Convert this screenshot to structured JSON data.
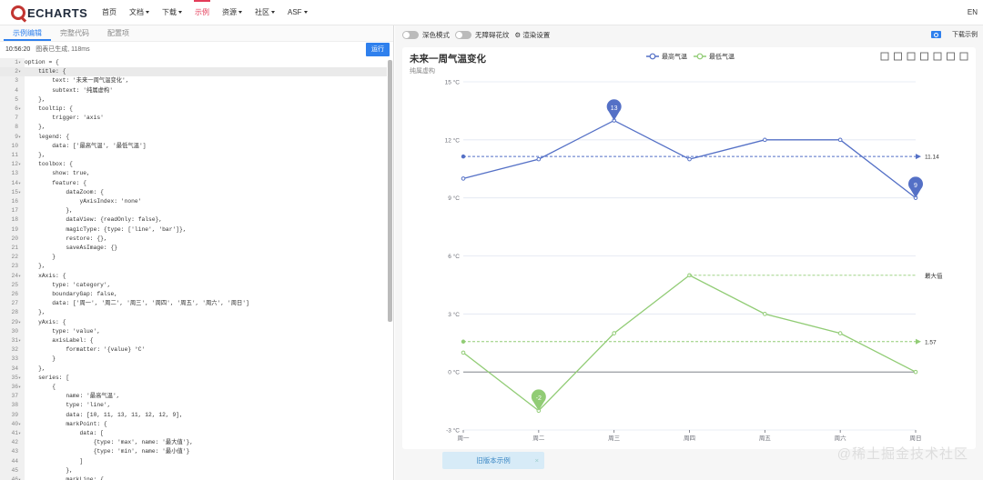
{
  "nav": {
    "logo_text": "ECHARTS",
    "items": [
      {
        "label": "首页",
        "dropdown": false,
        "active": false
      },
      {
        "label": "文档",
        "dropdown": true,
        "active": false
      },
      {
        "label": "下载",
        "dropdown": true,
        "active": false
      },
      {
        "label": "示例",
        "dropdown": false,
        "active": true
      },
      {
        "label": "资源",
        "dropdown": true,
        "active": false
      },
      {
        "label": "社区",
        "dropdown": true,
        "active": false
      },
      {
        "label": "ASF",
        "dropdown": true,
        "active": false
      }
    ],
    "lang": "EN",
    "accent_color": "#e43c59"
  },
  "editor": {
    "tabs": [
      "示例编辑",
      "完整代码",
      "配置项"
    ],
    "status_time": "10:56:20",
    "status_text": "图表已生成, 118ms",
    "run_label": "运行",
    "lines": [
      {
        "n": "1",
        "fold": "▾",
        "text": "option = {"
      },
      {
        "n": "2",
        "fold": "▾",
        "text": "    title: {"
      },
      {
        "n": "3",
        "fold": "",
        "text": "        text: '未来一周气温变化',"
      },
      {
        "n": "4",
        "fold": "",
        "text": "        subtext: '纯属虚构'"
      },
      {
        "n": "5",
        "fold": "",
        "text": "    },"
      },
      {
        "n": "6",
        "fold": "▾",
        "text": "    tooltip: {"
      },
      {
        "n": "7",
        "fold": "",
        "text": "        trigger: 'axis'"
      },
      {
        "n": "8",
        "fold": "",
        "text": "    },"
      },
      {
        "n": "9",
        "fold": "▾",
        "text": "    legend: {"
      },
      {
        "n": "10",
        "fold": "",
        "text": "        data: ['最高气温', '最低气温']"
      },
      {
        "n": "11",
        "fold": "",
        "text": "    },"
      },
      {
        "n": "12",
        "fold": "▾",
        "text": "    toolbox: {"
      },
      {
        "n": "13",
        "fold": "",
        "text": "        show: true,"
      },
      {
        "n": "14",
        "fold": "▾",
        "text": "        feature: {"
      },
      {
        "n": "15",
        "fold": "▾",
        "text": "            dataZoom: {"
      },
      {
        "n": "16",
        "fold": "",
        "text": "                yAxisIndex: 'none'"
      },
      {
        "n": "17",
        "fold": "",
        "text": "            },"
      },
      {
        "n": "18",
        "fold": "",
        "text": "            dataView: {readOnly: false},"
      },
      {
        "n": "19",
        "fold": "",
        "text": "            magicType: {type: ['line', 'bar']},"
      },
      {
        "n": "20",
        "fold": "",
        "text": "            restore: {},"
      },
      {
        "n": "21",
        "fold": "",
        "text": "            saveAsImage: {}"
      },
      {
        "n": "22",
        "fold": "",
        "text": "        }"
      },
      {
        "n": "23",
        "fold": "",
        "text": "    },"
      },
      {
        "n": "24",
        "fold": "▾",
        "text": "    xAxis: {"
      },
      {
        "n": "25",
        "fold": "",
        "text": "        type: 'category',"
      },
      {
        "n": "26",
        "fold": "",
        "text": "        boundaryGap: false,"
      },
      {
        "n": "27",
        "fold": "",
        "text": "        data: ['周一', '周二', '周三', '周四', '周五', '周六', '周日']"
      },
      {
        "n": "28",
        "fold": "",
        "text": "    },"
      },
      {
        "n": "29",
        "fold": "▾",
        "text": "    yAxis: {"
      },
      {
        "n": "30",
        "fold": "",
        "text": "        type: 'value',"
      },
      {
        "n": "31",
        "fold": "▾",
        "text": "        axisLabel: {"
      },
      {
        "n": "32",
        "fold": "",
        "text": "            formatter: '{value} °C'"
      },
      {
        "n": "33",
        "fold": "",
        "text": "        }"
      },
      {
        "n": "34",
        "fold": "",
        "text": "    },"
      },
      {
        "n": "35",
        "fold": "▾",
        "text": "    series: ["
      },
      {
        "n": "36",
        "fold": "▾",
        "text": "        {"
      },
      {
        "n": "37",
        "fold": "",
        "text": "            name: '最高气温',"
      },
      {
        "n": "38",
        "fold": "",
        "text": "            type: 'line',"
      },
      {
        "n": "39",
        "fold": "",
        "text": "            data: [10, 11, 13, 11, 12, 12, 9],"
      },
      {
        "n": "40",
        "fold": "▾",
        "text": "            markPoint: {"
      },
      {
        "n": "41",
        "fold": "▾",
        "text": "                data: ["
      },
      {
        "n": "42",
        "fold": "",
        "text": "                    {type: 'max', name: '最大值'},"
      },
      {
        "n": "43",
        "fold": "",
        "text": "                    {type: 'min', name: '最小值'}"
      },
      {
        "n": "44",
        "fold": "",
        "text": "                ]"
      },
      {
        "n": "45",
        "fold": "",
        "text": "            },"
      },
      {
        "n": "46",
        "fold": "▾",
        "text": "            markLine: {"
      }
    ]
  },
  "preview": {
    "dark_mode_label": "深色模式",
    "no_decal_label": "无障碍花纹",
    "render_settings_label": "渲染设置",
    "download_label": "下载示例",
    "old_example_label": "旧版本示例",
    "old_example_close": "×",
    "watermark": "@稀土掘金技术社区"
  },
  "chart_data": {
    "type": "line",
    "title": "未来一周气温变化",
    "subtitle": "纯属虚构",
    "categories": [
      "周一",
      "周二",
      "周三",
      "周四",
      "周五",
      "周六",
      "周日"
    ],
    "ylim": [
      -3,
      15
    ],
    "yticks": [
      "-3 °C",
      "0 °C",
      "3 °C",
      "6 °C",
      "9 °C",
      "12 °C",
      "15 °C"
    ],
    "ytick_values": [
      -3,
      0,
      3,
      6,
      9,
      12,
      15
    ],
    "legend_placement": "top-center",
    "grid": true,
    "series": [
      {
        "name": "最高气温",
        "color": "#5470c6",
        "values": [
          10,
          11,
          13,
          11,
          12,
          12,
          9
        ],
        "mark_points": [
          {
            "label": "13",
            "index": 2,
            "value": 13
          },
          {
            "label": "9",
            "index": 6,
            "value": 9
          }
        ],
        "mark_line": {
          "value": 11.14,
          "label": "11.14"
        }
      },
      {
        "name": "最低气温",
        "color": "#91cc75",
        "values": [
          1,
          -2,
          2,
          5,
          3,
          2,
          0
        ],
        "mark_points": [
          {
            "label": "-2",
            "index": 1,
            "value": -2
          }
        ],
        "mark_line": {
          "value": 1.57,
          "label": "1.57"
        },
        "mark_line_max": {
          "value": 5,
          "label": "最大值"
        }
      }
    ]
  }
}
